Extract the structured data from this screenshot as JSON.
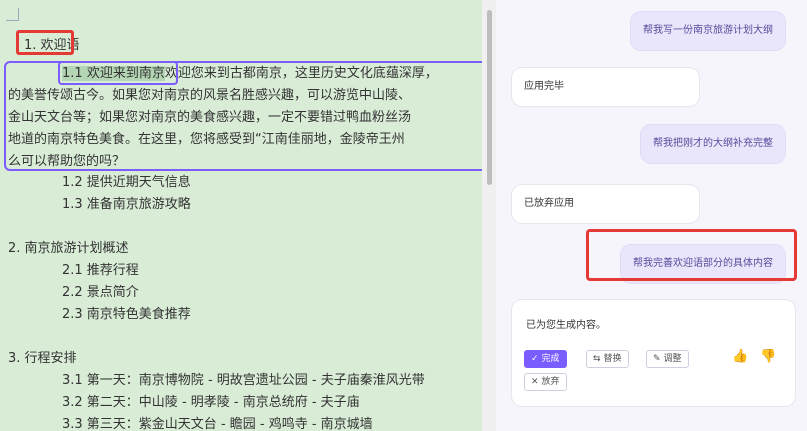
{
  "document": {
    "heading1": "1. 欢迎语",
    "item_1_1_prefix": "1.1",
    "item_1_1_selected": " 欢迎来到南京",
    "item_1_1_rest": "欢迎您来到古都南京，这里历史文化底蕴深厚，",
    "para_lines": [
      "的美誉传颂古今。如果您对南京的风景名胜感兴趣，可以游览中山陵、",
      "金山天文台等；如果您对南京的美食感兴趣，一定不要错过鸭血粉丝汤",
      "地道的南京特色美食。在这里，您将感受到“江南佳丽地，金陵帝王州",
      "么可以帮助您的吗？"
    ],
    "item_1_2": "1.2 提供近期天气信息",
    "item_1_3": "1.3 准备南京旅游攻略",
    "heading2": "2. 南京旅游计划概述",
    "item_2_1": "2.1 推荐行程",
    "item_2_2": "2.2 景点简介",
    "item_2_3": "2.3 南京特色美食推荐",
    "heading3": "3. 行程安排",
    "item_3_1": "3.1 第一天：南京博物院 - 明故宫遗址公园 - 夫子庙秦淮风光带",
    "item_3_2": "3.2 第二天：中山陵 - 明孝陵 - 南京总统府 - 夫子庙",
    "item_3_3": "3.3 第三天：紫金山天文台 - 瞻园 - 鸡鸣寺 - 南京城墙"
  },
  "chat": {
    "msg1_user": "帮我写一份南京旅游计划大纲",
    "msg2_ai": "应用完毕",
    "msg3_user": "帮我把刚才的大纲补充完整",
    "msg4_ai": "已放弃应用",
    "msg5_user": "帮我完善欢迎语部分的具体内容",
    "card_text": "已为您生成内容。",
    "btn_done": "完成",
    "btn_replace": "替换",
    "btn_adjust": "调整",
    "btn_discard": "放弃"
  },
  "icons": {
    "done": "check-icon",
    "replace": "swap-icon",
    "adjust": "magic-pen-icon",
    "discard": "close-icon",
    "like": "thumbs-up-icon",
    "dislike": "thumbs-down-icon"
  },
  "colors": {
    "doc_bg": "#d8ecd6",
    "accent": "#7b5cff",
    "highlight_red": "#e53935"
  }
}
